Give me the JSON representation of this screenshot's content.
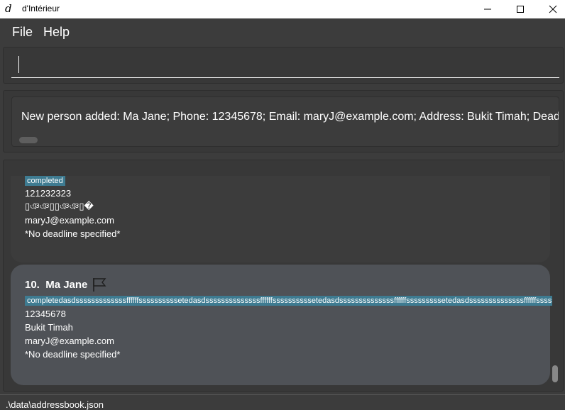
{
  "window": {
    "title": "d'Intérieur",
    "app_icon_glyph": "d",
    "icons": [
      "minimize-icon",
      "maximize-icon",
      "close-icon"
    ]
  },
  "menu": {
    "file": "File",
    "help": "Help"
  },
  "command": {
    "value": "",
    "placeholder": ""
  },
  "result": {
    "text": "New person added: Ma Jane; Phone: 12345678; Email: maryJ@example.com; Address: Bukit Timah; Dead"
  },
  "persons": [
    {
      "tag": "completed",
      "phone": "121232323",
      "address": "▯ঞঞ▯▯ঞঞ▯�",
      "email": "maryJ@example.com",
      "deadline": " *No deadline specified*"
    },
    {
      "index": "10.",
      "name": "Ma Jane",
      "flag_icon": "flag-icon",
      "tag": "completedasdsssssssssssssffffffssssssssssetedasdssssssssssssssffffffssssssssssetedasdssssssssssssssffffffsssssssssetedasdssssssssssssssffffffssssssssse",
      "phone": "12345678",
      "address": "Bukit Timah",
      "email": "maryJ@example.com",
      "deadline": " *No deadline specified*"
    }
  ],
  "status": {
    "path": ".\\data\\addressbook.json"
  },
  "colors": {
    "background": "#3c3c3c",
    "tag": "#3e7b91",
    "selected_card": "#4f5257"
  }
}
